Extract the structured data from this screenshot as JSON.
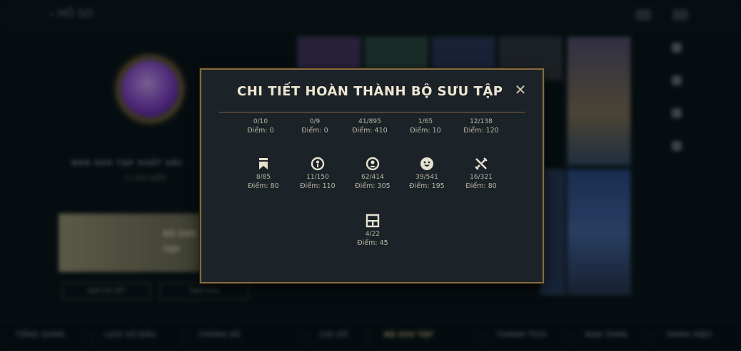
{
  "app": {
    "back_label": "HỒ SƠ",
    "bg_title": "NHÀ SƯU TẬP XUẤT SẮC",
    "bg_points": "11.400 ĐIỂM",
    "banner_lines": [
      "BỘ SƯU",
      "TẬP"
    ],
    "bg_buttons": [
      "XEM CHI TIẾT",
      "THEO MÙA"
    ],
    "side_items": [
      "",
      "",
      "",
      ""
    ],
    "bottom_nav": [
      {
        "label": "TỔNG QUAN",
        "active": false
      },
      {
        "label": "LỊCH SỬ ĐẤU",
        "active": false
      },
      {
        "label": "THÔNG KÊ",
        "active": false
      },
      {
        "label": "CHI SỐ",
        "active": false
      },
      {
        "label": "BỘ SƯU TẬP",
        "active": true
      },
      {
        "label": "THÀNH TÍCH",
        "active": false
      },
      {
        "label": "BẠN THÂN",
        "active": false
      },
      {
        "label": "DANH HIỆU",
        "active": false
      }
    ]
  },
  "modal": {
    "title": "CHI TIẾT HOÀN THÀNH BỘ SƯU TẬP",
    "close_glyph": "✕",
    "rows": [
      [
        {
          "count": "0/10",
          "points": "Điểm: 0"
        },
        {
          "count": "0/9",
          "points": "Điểm: 0"
        },
        {
          "count": "41/895",
          "points": "Điểm: 410"
        },
        {
          "count": "1/65",
          "points": "Điểm: 10"
        },
        {
          "count": "12/138",
          "points": "Điểm: 120"
        }
      ],
      [
        {
          "icon": "banner-icon",
          "count": "8/85",
          "points": "Điểm: 80"
        },
        {
          "icon": "ward-icon",
          "count": "11/150",
          "points": "Điểm: 110"
        },
        {
          "icon": "profile-icon",
          "count": "62/414",
          "points": "Điểm: 305"
        },
        {
          "icon": "emote-icon",
          "count": "39/541",
          "points": "Điểm: 195"
        },
        {
          "icon": "crossed-swords-icon",
          "count": "16/321",
          "points": "Điểm: 80"
        }
      ],
      [
        {
          "icon": "frame-icon",
          "count": "4/22",
          "points": "Điểm: 45"
        }
      ]
    ]
  }
}
